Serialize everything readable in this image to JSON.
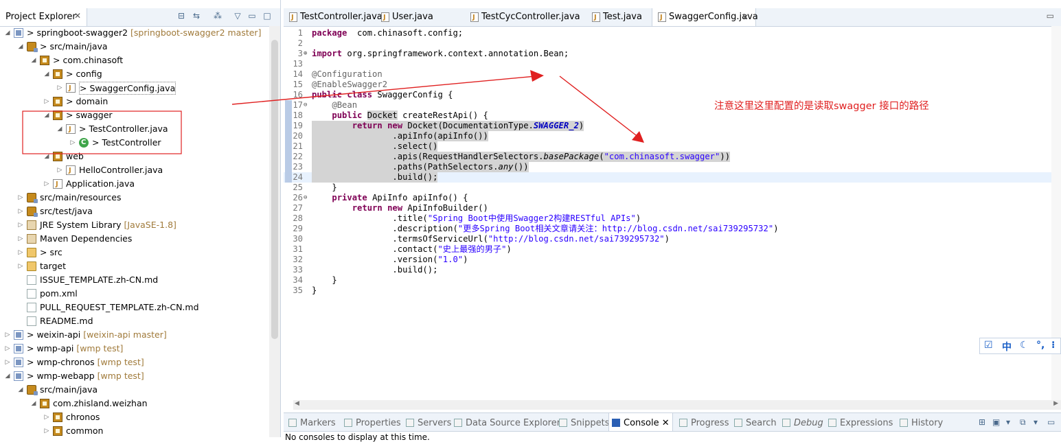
{
  "explorer": {
    "title": "Project Explorer",
    "tree": [
      {
        "indent": 0,
        "exp": "down",
        "icon": "proj",
        "label": "> springboot-swagger2",
        "dec": "[springboot-swagger2 master]",
        "name": "tree-item-springboot-swagger2"
      },
      {
        "indent": 1,
        "exp": "down",
        "icon": "src",
        "label": "> src/main/java",
        "dec": "",
        "name": "tree-item-src-main-java"
      },
      {
        "indent": 2,
        "exp": "down",
        "icon": "pkg",
        "label": "> com.chinasoft",
        "dec": "",
        "name": "tree-item-com-chinasoft"
      },
      {
        "indent": 3,
        "exp": "down",
        "icon": "pkg",
        "label": "> config",
        "dec": "",
        "name": "tree-item-config"
      },
      {
        "indent": 4,
        "exp": "right",
        "icon": "java",
        "label": "> SwaggerConfig.java",
        "dec": "",
        "name": "tree-item-swaggerconfig-java",
        "sel": true
      },
      {
        "indent": 3,
        "exp": "right",
        "icon": "pkg",
        "label": "> domain",
        "dec": "",
        "name": "tree-item-domain"
      },
      {
        "indent": 3,
        "exp": "down",
        "icon": "pkg",
        "label": "> swagger",
        "dec": "",
        "name": "tree-item-swagger"
      },
      {
        "indent": 4,
        "exp": "down",
        "icon": "java",
        "label": "> TestController.java",
        "dec": "",
        "name": "tree-item-testcontroller-java"
      },
      {
        "indent": 5,
        "exp": "right",
        "icon": "cls",
        "label": "> TestController",
        "dec": "",
        "name": "tree-item-testcontroller-class"
      },
      {
        "indent": 3,
        "exp": "down",
        "icon": "pkg",
        "label": "web",
        "dec": "",
        "name": "tree-item-web"
      },
      {
        "indent": 4,
        "exp": "right",
        "icon": "java",
        "label": "HelloController.java",
        "dec": "",
        "name": "tree-item-hellocontroller-java"
      },
      {
        "indent": 3,
        "exp": "right",
        "icon": "java",
        "label": "Application.java",
        "dec": "",
        "name": "tree-item-application-java"
      },
      {
        "indent": 1,
        "exp": "right",
        "icon": "src",
        "label": "src/main/resources",
        "dec": "",
        "name": "tree-item-src-main-resources"
      },
      {
        "indent": 1,
        "exp": "right",
        "icon": "src",
        "label": "src/test/java",
        "dec": "",
        "name": "tree-item-src-test-java"
      },
      {
        "indent": 1,
        "exp": "right",
        "icon": "lib",
        "label": "JRE System Library",
        "dec": "[JavaSE-1.8]",
        "name": "tree-item-jre-system-library"
      },
      {
        "indent": 1,
        "exp": "right",
        "icon": "lib",
        "label": "Maven Dependencies",
        "dec": "",
        "name": "tree-item-maven-dependencies"
      },
      {
        "indent": 1,
        "exp": "right",
        "icon": "folder",
        "label": "> src",
        "dec": "",
        "name": "tree-item-src"
      },
      {
        "indent": 1,
        "exp": "right",
        "icon": "folder",
        "label": "target",
        "dec": "",
        "name": "tree-item-target"
      },
      {
        "indent": 1,
        "exp": "",
        "icon": "file",
        "label": "ISSUE_TEMPLATE.zh-CN.md",
        "dec": "",
        "name": "tree-item-issue-template"
      },
      {
        "indent": 1,
        "exp": "",
        "icon": "file",
        "label": "pom.xml",
        "dec": "",
        "name": "tree-item-pom-xml"
      },
      {
        "indent": 1,
        "exp": "",
        "icon": "file",
        "label": "PULL_REQUEST_TEMPLATE.zh-CN.md",
        "dec": "",
        "name": "tree-item-pull-request-template"
      },
      {
        "indent": 1,
        "exp": "",
        "icon": "file",
        "label": "README.md",
        "dec": "",
        "name": "tree-item-readme"
      },
      {
        "indent": 0,
        "exp": "right",
        "icon": "proj",
        "label": "> weixin-api",
        "dec": "[weixin-api master]",
        "name": "tree-item-weixin-api"
      },
      {
        "indent": 0,
        "exp": "right",
        "icon": "proj",
        "label": "> wmp-api",
        "dec": "[wmp test]",
        "name": "tree-item-wmp-api"
      },
      {
        "indent": 0,
        "exp": "right",
        "icon": "proj",
        "label": "> wmp-chronos",
        "dec": "[wmp test]",
        "name": "tree-item-wmp-chronos"
      },
      {
        "indent": 0,
        "exp": "down",
        "icon": "proj",
        "label": "> wmp-webapp",
        "dec": "[wmp test]",
        "name": "tree-item-wmp-webapp"
      },
      {
        "indent": 1,
        "exp": "down",
        "icon": "src",
        "label": "src/main/java",
        "dec": "",
        "name": "tree-item-wmp-src-main-java"
      },
      {
        "indent": 2,
        "exp": "down",
        "icon": "pkg",
        "label": "com.zhisland.weizhan",
        "dec": "",
        "name": "tree-item-com-zhisland-weizhan"
      },
      {
        "indent": 3,
        "exp": "right",
        "icon": "pkg",
        "label": "chronos",
        "dec": "",
        "name": "tree-item-chronos"
      },
      {
        "indent": 3,
        "exp": "right",
        "icon": "pkg",
        "label": "common",
        "dec": "",
        "name": "tree-item-common"
      }
    ]
  },
  "editor": {
    "tabs": [
      {
        "label": "TestController.java",
        "name": "tab-testcontroller"
      },
      {
        "label": "User.java",
        "name": "tab-user"
      },
      {
        "label": "TestCycController.java",
        "name": "tab-testcyccontroller"
      },
      {
        "label": "Test.java",
        "name": "tab-test"
      },
      {
        "label": "SwaggerConfig.java",
        "name": "tab-swaggerconfig",
        "active": true
      }
    ],
    "lines": [
      {
        "n": "1",
        "t": [
          [
            "k",
            "package"
          ],
          [
            "",
            "  com.chinasoft.config;"
          ]
        ]
      },
      {
        "n": "2",
        "t": []
      },
      {
        "n": "3",
        "fold": "+",
        "t": [
          [
            "k",
            "import"
          ],
          [
            "",
            " org.springframework.context.annotation.Bean;"
          ]
        ]
      },
      {
        "n": "13",
        "t": []
      },
      {
        "n": "14",
        "t": [
          [
            "a",
            "@Configuration"
          ]
        ]
      },
      {
        "n": "15",
        "t": [
          [
            "a",
            "@EnableSwagger2"
          ]
        ]
      },
      {
        "n": "16",
        "t": [
          [
            "k",
            "public"
          ],
          [
            "",
            " "
          ],
          [
            "k",
            "class"
          ],
          [
            "",
            " SwaggerConfig {"
          ]
        ]
      },
      {
        "n": "17",
        "fold": "-",
        "t": [
          [
            "",
            "    "
          ],
          [
            "a",
            "@Bean"
          ]
        ]
      },
      {
        "n": "18",
        "t": [
          [
            "",
            "    "
          ],
          [
            "k",
            "public"
          ],
          [
            "",
            " "
          ],
          [
            "ov",
            "Docket"
          ],
          [
            "",
            " createRestApi() {"
          ]
        ]
      },
      {
        "n": "19",
        "hl": true,
        "t": [
          [
            "",
            "        "
          ],
          [
            "k",
            "return"
          ],
          [
            "",
            " "
          ],
          [
            "k",
            "new"
          ],
          [
            "",
            " Docket(DocumentationType."
          ],
          [
            "st",
            "SWAGGER_2"
          ],
          [
            "",
            ")"
          ]
        ]
      },
      {
        "n": "20",
        "hl": true,
        "t": [
          [
            "",
            "                .apiInfo(apiInfo())"
          ]
        ]
      },
      {
        "n": "21",
        "hl": true,
        "t": [
          [
            "",
            "                .select()"
          ]
        ]
      },
      {
        "n": "22",
        "hl": true,
        "t": [
          [
            "",
            "                .apis(RequestHandlerSelectors."
          ],
          [
            "it",
            "basePackage"
          ],
          [
            "",
            "("
          ],
          [
            "s",
            "\"com.chinasoft.swagger\""
          ],
          [
            "",
            "))"
          ]
        ]
      },
      {
        "n": "23",
        "hl": true,
        "t": [
          [
            "",
            "                .paths(PathSelectors."
          ],
          [
            "it",
            "any"
          ],
          [
            "",
            "())"
          ]
        ]
      },
      {
        "n": "24",
        "hl": true,
        "cur": true,
        "t": [
          [
            "",
            "                .build();"
          ]
        ]
      },
      {
        "n": "25",
        "t": [
          [
            "",
            "    }"
          ]
        ]
      },
      {
        "n": "26",
        "fold": "-",
        "t": [
          [
            "",
            "    "
          ],
          [
            "k",
            "private"
          ],
          [
            "",
            " ApiInfo apiInfo() {"
          ]
        ]
      },
      {
        "n": "27",
        "t": [
          [
            "",
            "        "
          ],
          [
            "k",
            "return"
          ],
          [
            "",
            " "
          ],
          [
            "k",
            "new"
          ],
          [
            "",
            " ApiInfoBuilder()"
          ]
        ]
      },
      {
        "n": "28",
        "t": [
          [
            "",
            "                .title("
          ],
          [
            "s",
            "\"Spring Boot中使用Swagger2构建RESTful APIs\""
          ],
          [
            "",
            ")"
          ]
        ]
      },
      {
        "n": "29",
        "t": [
          [
            "",
            "                .description("
          ],
          [
            "s",
            "\"更多Spring Boot相关文章请关注：http://blog.csdn.net/sai739295732\""
          ],
          [
            "",
            ")"
          ]
        ]
      },
      {
        "n": "30",
        "t": [
          [
            "",
            "                .termsOfServiceUrl("
          ],
          [
            "s",
            "\"http://blog.csdn.net/sai739295732\""
          ],
          [
            "",
            ")"
          ]
        ]
      },
      {
        "n": "31",
        "t": [
          [
            "",
            "                .contact("
          ],
          [
            "s",
            "\"史上最强的男子\""
          ],
          [
            "",
            ")"
          ]
        ]
      },
      {
        "n": "32",
        "t": [
          [
            "",
            "                .version("
          ],
          [
            "s",
            "\"1.0\""
          ],
          [
            "",
            ")"
          ]
        ]
      },
      {
        "n": "33",
        "t": [
          [
            "",
            "                .build();"
          ]
        ]
      },
      {
        "n": "34",
        "t": [
          [
            "",
            "    }"
          ]
        ]
      },
      {
        "n": "35",
        "t": [
          [
            "",
            "}"
          ]
        ]
      }
    ]
  },
  "annotation": "注意这里这里配置的是读取swagger 接口的路径",
  "ime": {
    "lang": "中"
  },
  "bottom": {
    "tabs": [
      {
        "label": "Markers",
        "name": "tab-markers"
      },
      {
        "label": "Properties",
        "name": "tab-properties"
      },
      {
        "label": "Servers",
        "name": "tab-servers"
      },
      {
        "label": "Data Source Explorer",
        "name": "tab-data-source-explorer"
      },
      {
        "label": "Snippets",
        "name": "tab-snippets"
      },
      {
        "label": "Console",
        "name": "tab-console",
        "active": true
      },
      {
        "label": "Progress",
        "name": "tab-progress"
      },
      {
        "label": "Search",
        "name": "tab-search"
      },
      {
        "label": "Debug",
        "name": "tab-debug",
        "italic": true
      },
      {
        "label": "Expressions",
        "name": "tab-expressions"
      },
      {
        "label": "History",
        "name": "tab-history"
      }
    ],
    "console_msg": "No consoles to display at this time."
  },
  "colors": {
    "annotation": "#e02020",
    "keyword": "#7f0055",
    "string": "#2a00ff"
  }
}
